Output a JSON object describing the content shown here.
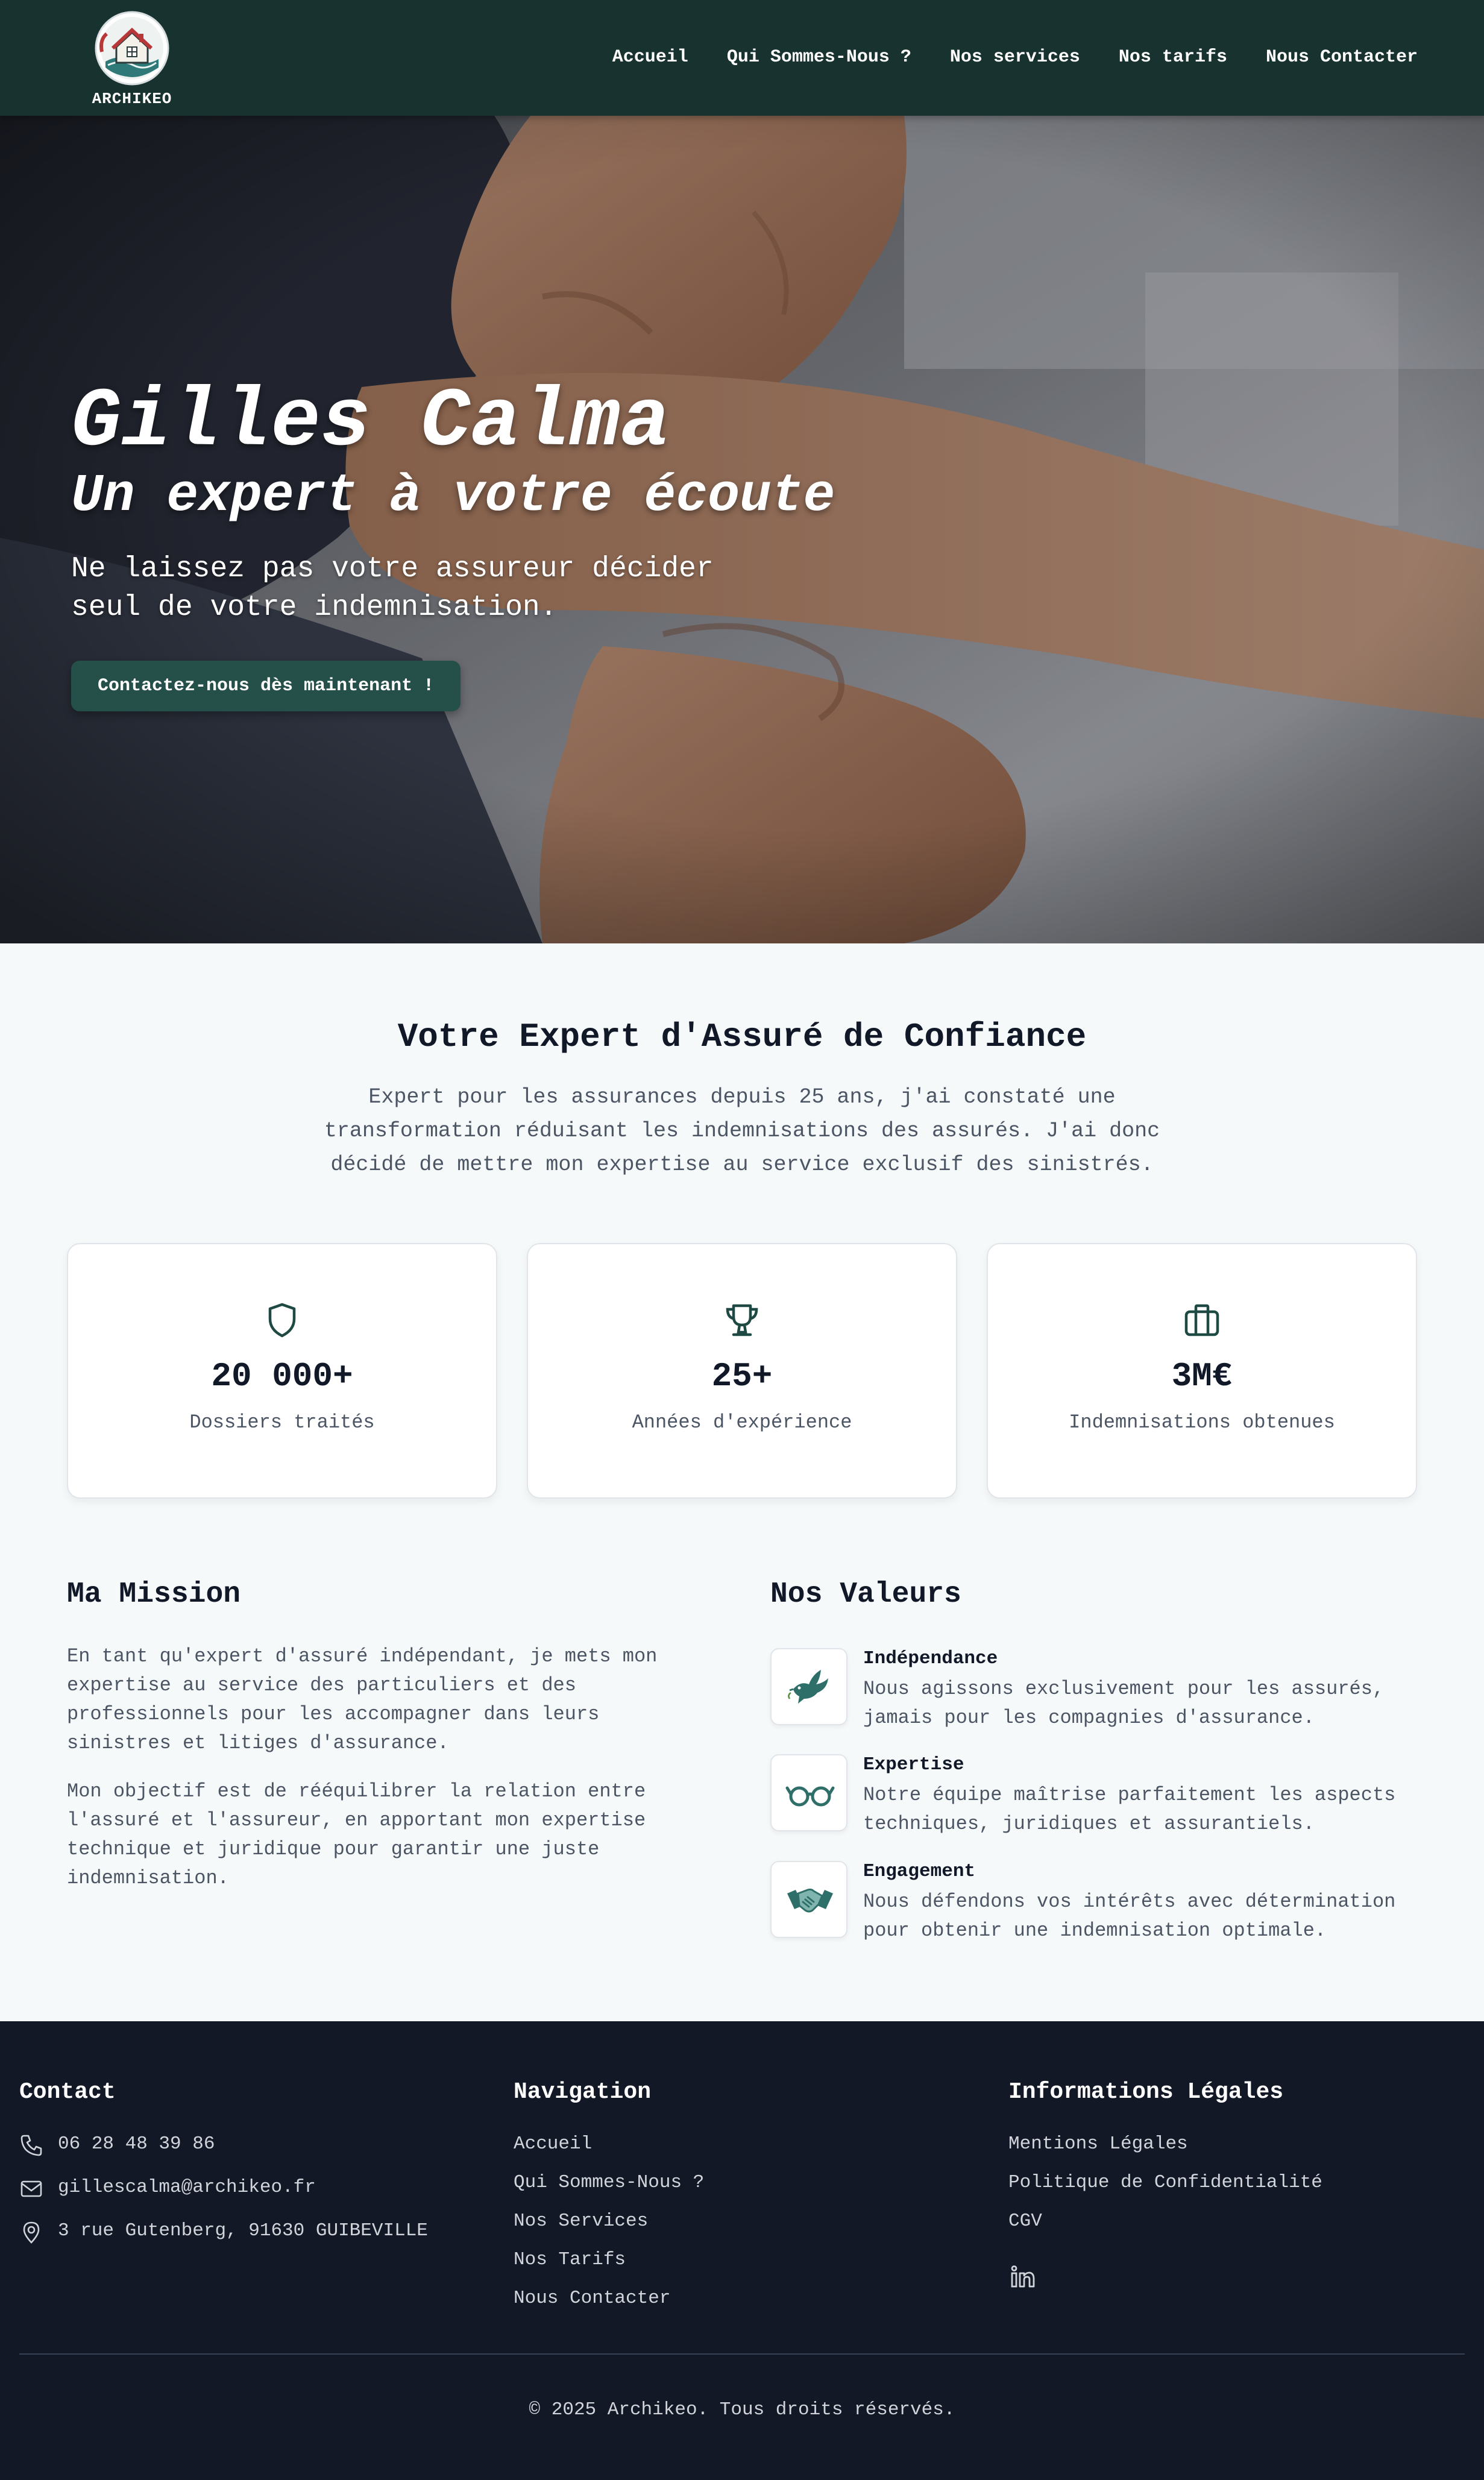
{
  "nav": {
    "logo_text": "ARCHIKEO",
    "links": [
      "Accueil",
      "Qui Sommes-Nous ?",
      "Nos services",
      "Nos tarifs",
      "Nous Contacter"
    ]
  },
  "hero": {
    "title": "Gilles Calma",
    "subtitle": "Un expert à votre écoute",
    "text": "Ne laissez pas votre assureur décider seul de votre indemnisation.",
    "cta": "Contactez-nous dès maintenant !"
  },
  "about": {
    "title": "Votre Expert d'Assuré de Confiance",
    "intro": "Expert pour les assurances depuis 25 ans, j'ai constaté une transformation réduisant les indemnisations des assurés. J'ai donc décidé de mettre mon expertise au service exclusif des sinistrés.",
    "stats": [
      {
        "icon": "shield-icon",
        "value": "20 000+",
        "label": "Dossiers traités"
      },
      {
        "icon": "trophy-icon",
        "value": "25+",
        "label": "Années d'expérience"
      },
      {
        "icon": "briefcase-icon",
        "value": "3M€",
        "label": "Indemnisations obtenues"
      }
    ]
  },
  "mission": {
    "title": "Ma Mission",
    "p1": "En tant qu'expert d'assuré indépendant, je mets mon expertise au service des particuliers et des professionnels pour les accompagner dans leurs sinistres et litiges d'assurance.",
    "p2": "Mon objectif est de rééquilibrer la relation entre l'assuré et l'assureur, en apportant mon expertise technique et juridique pour garantir une juste indemnisation."
  },
  "values": {
    "title": "Nos Valeurs",
    "items": [
      {
        "icon": "dove-icon",
        "title": "Indépendance",
        "text": "Nous agissons exclusivement pour les assurés, jamais pour les compagnies d'assurance."
      },
      {
        "icon": "glasses-icon",
        "title": "Expertise",
        "text": "Notre équipe maîtrise parfaitement les aspects techniques, juridiques et assurantiels."
      },
      {
        "icon": "handshake-icon",
        "title": "Engagement",
        "text": "Nous défendons vos intérêts avec détermination pour obtenir une indemnisation optimale."
      }
    ]
  },
  "footer": {
    "contact": {
      "title": "Contact",
      "phone": "06 28 48 39 86",
      "email": "gillescalma@archikeo.fr",
      "address": "3 rue Gutenberg, 91630 GUIBEVILLE"
    },
    "navigation": {
      "title": "Navigation",
      "links": [
        "Accueil",
        "Qui Sommes-Nous ?",
        "Nos Services",
        "Nos Tarifs",
        "Nous Contacter"
      ]
    },
    "legal": {
      "title": "Informations Légales",
      "links": [
        "Mentions Légales",
        "Politique de Confidentialité",
        "CGV"
      ]
    },
    "copyright": "© 2025 Archikeo. Tous droits réservés."
  },
  "colors": {
    "nav_bg": "#17322f",
    "accent": "#255049",
    "footer_bg": "#131826",
    "page_bg": "#f6f9fa"
  }
}
